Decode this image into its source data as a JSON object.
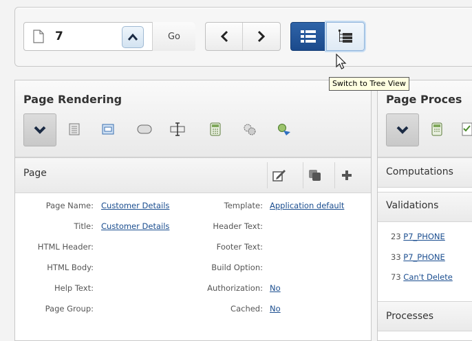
{
  "toolbar": {
    "page_number": "7",
    "go_label": "Go",
    "tooltip": "Switch to Tree View"
  },
  "rendering": {
    "title": "Page Rendering",
    "page_section": {
      "title": "Page"
    },
    "left_fields": [
      {
        "label": "Page Name:",
        "value": "Customer Details"
      },
      {
        "label": "Title:",
        "value": "Customer Details"
      },
      {
        "label": "HTML Header:",
        "value": ""
      },
      {
        "label": "HTML Body:",
        "value": ""
      },
      {
        "label": "Help Text:",
        "value": ""
      },
      {
        "label": "Page Group:",
        "value": ""
      }
    ],
    "right_fields": [
      {
        "label": "Template:",
        "value": "Application default"
      },
      {
        "label": "Header Text:",
        "value": ""
      },
      {
        "label": "Footer Text:",
        "value": ""
      },
      {
        "label": "Build Option:",
        "value": ""
      },
      {
        "label": "Authorization:",
        "value": "No"
      },
      {
        "label": "Cached:",
        "value": "No"
      }
    ]
  },
  "processing": {
    "title": "Page Proces",
    "computations_label": "Computations",
    "validations_label": "Validations",
    "validations": [
      {
        "num": "23",
        "name": "P7_PHONE"
      },
      {
        "num": "33",
        "name": "P7_PHONE"
      },
      {
        "num": "73",
        "name": "Can't Delete"
      }
    ],
    "processes_label": "Processes"
  }
}
